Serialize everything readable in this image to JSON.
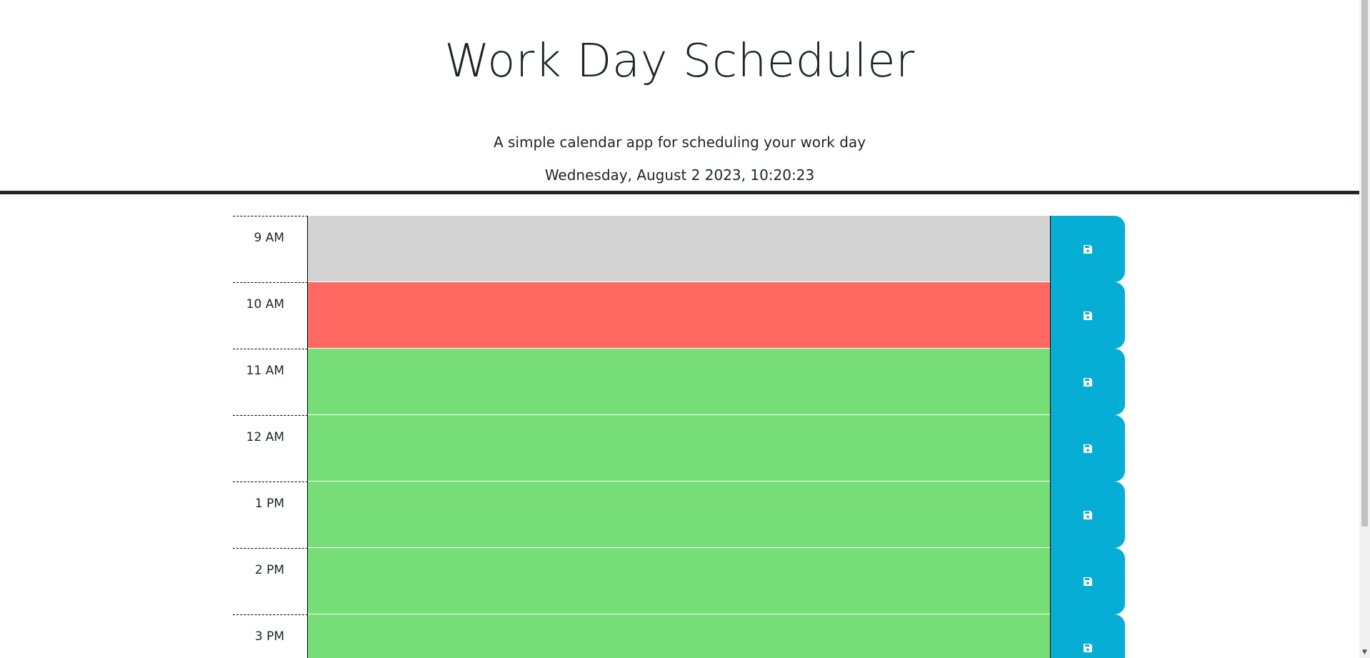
{
  "header": {
    "title": "Work Day Scheduler",
    "subtitle": "A simple calendar app for scheduling your work day",
    "current_datetime": "Wednesday, August 2 2023, 10:20:23"
  },
  "time_blocks": [
    {
      "hour_label": "9 AM",
      "status": "past",
      "text": ""
    },
    {
      "hour_label": "10 AM",
      "status": "present",
      "text": ""
    },
    {
      "hour_label": "11 AM",
      "status": "future",
      "text": ""
    },
    {
      "hour_label": "12 AM",
      "status": "future",
      "text": ""
    },
    {
      "hour_label": "1 PM",
      "status": "future",
      "text": ""
    },
    {
      "hour_label": "2 PM",
      "status": "future",
      "text": ""
    },
    {
      "hour_label": "3 PM",
      "status": "future",
      "text": ""
    }
  ],
  "save_button": {
    "icon": "save-icon"
  },
  "colors": {
    "past": "#d3d3d3",
    "present": "#ff6961",
    "future": "#77dd77",
    "save_button": "#06aed5",
    "header_rule": "#212529"
  },
  "scrollbar": {
    "up_arrow": "▲",
    "down_arrow": "▼"
  }
}
